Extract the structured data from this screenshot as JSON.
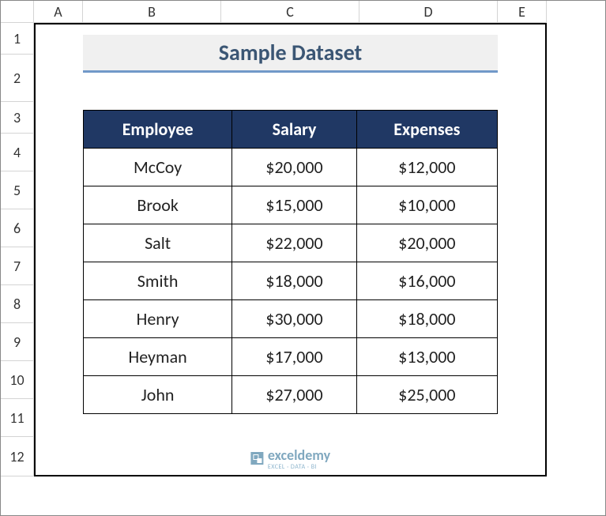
{
  "columns": [
    "",
    "A",
    "B",
    "C",
    "D",
    "E"
  ],
  "rows": [
    "1",
    "2",
    "3",
    "4",
    "5",
    "6",
    "7",
    "8",
    "9",
    "10",
    "11",
    "12"
  ],
  "title": "Sample Dataset",
  "table": {
    "headers": [
      "Employee",
      "Salary",
      "Expenses"
    ],
    "data": [
      {
        "employee": "McCoy",
        "salary": "$20,000",
        "expenses": "$12,000"
      },
      {
        "employee": "Brook",
        "salary": "$15,000",
        "expenses": "$10,000"
      },
      {
        "employee": "Salt",
        "salary": "$22,000",
        "expenses": "$20,000"
      },
      {
        "employee": "Smith",
        "salary": "$18,000",
        "expenses": "$16,000"
      },
      {
        "employee": "Henry",
        "salary": "$30,000",
        "expenses": "$18,000"
      },
      {
        "employee": "Heyman",
        "salary": "$17,000",
        "expenses": "$13,000"
      },
      {
        "employee": "John",
        "salary": "$27,000",
        "expenses": "$25,000"
      }
    ]
  },
  "watermark": {
    "brand": "exceldemy",
    "sub": "EXCEL · DATA · BI"
  },
  "chart_data": {
    "type": "table",
    "title": "Sample Dataset",
    "columns": [
      "Employee",
      "Salary",
      "Expenses"
    ],
    "rows": [
      [
        "McCoy",
        20000,
        12000
      ],
      [
        "Brook",
        15000,
        10000
      ],
      [
        "Salt",
        22000,
        20000
      ],
      [
        "Smith",
        18000,
        16000
      ],
      [
        "Henry",
        30000,
        18000
      ],
      [
        "Heyman",
        17000,
        13000
      ],
      [
        "John",
        27000,
        25000
      ]
    ]
  }
}
